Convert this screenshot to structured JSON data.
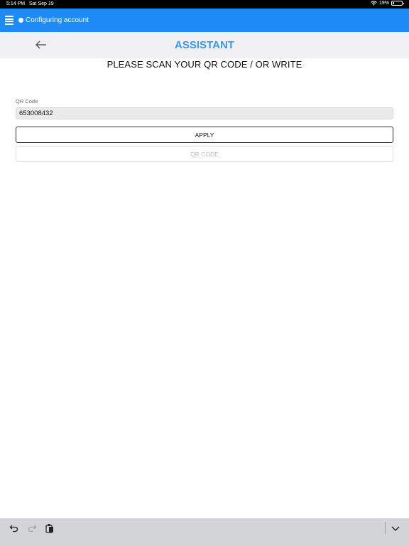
{
  "status_bar": {
    "time": "5:14 PM",
    "date": "Sat Sep 19",
    "battery": "19%",
    "battery_level": 0.19
  },
  "top_bar": {
    "title": "Configuring account"
  },
  "header": {
    "title": "ASSISTANT"
  },
  "main": {
    "instruction": "PLEASE SCAN YOUR QR CODE / OR WRITE",
    "qr_label": "QR Code",
    "qr_value": "653008432",
    "apply_label": "APPLY",
    "qr_button_label": "QR CODE"
  },
  "colors": {
    "top_bar": "#1e8af6",
    "header_title": "#3a98e6",
    "header_bg": "#efeff4",
    "keyboard_bar": "#d3d4d8"
  },
  "icons": [
    "menu-icon",
    "back-arrow-icon",
    "wifi-icon",
    "battery-icon",
    "undo-icon",
    "redo-icon",
    "paste-icon",
    "chevron-down-icon"
  ]
}
